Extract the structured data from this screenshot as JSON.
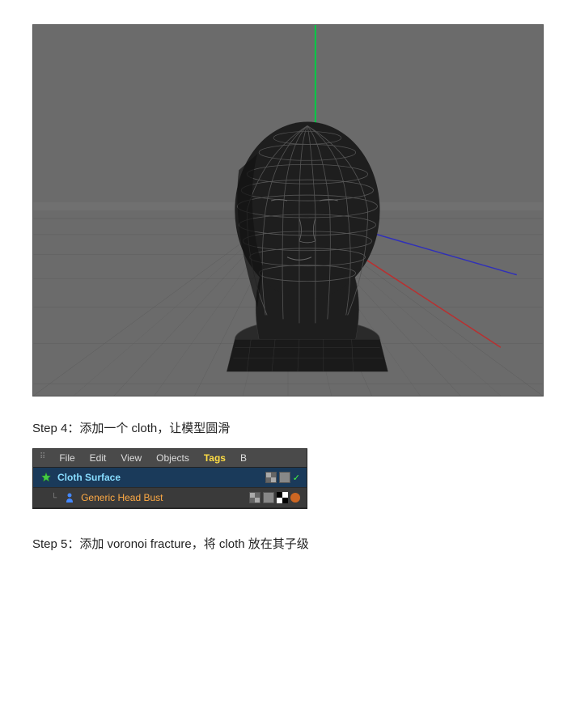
{
  "viewport": {
    "alt": "3D viewport showing a wireframe head bust model"
  },
  "step4": {
    "label": "Step 4：添加一个 cloth，让模型圆滑"
  },
  "step5": {
    "label": "Step 5：添加 voronoi fracture，将 cloth 放在其子级"
  },
  "menubar": {
    "file": "File",
    "edit": "Edit",
    "view": "View",
    "objects": "Objects",
    "tags": "Tags",
    "bookmarks": "B"
  },
  "objects": [
    {
      "name": "Cloth Surface",
      "type": "cloth",
      "selected": true,
      "indent": false
    },
    {
      "name": "Generic Head Bust",
      "type": "generic",
      "selected": false,
      "indent": true
    }
  ]
}
